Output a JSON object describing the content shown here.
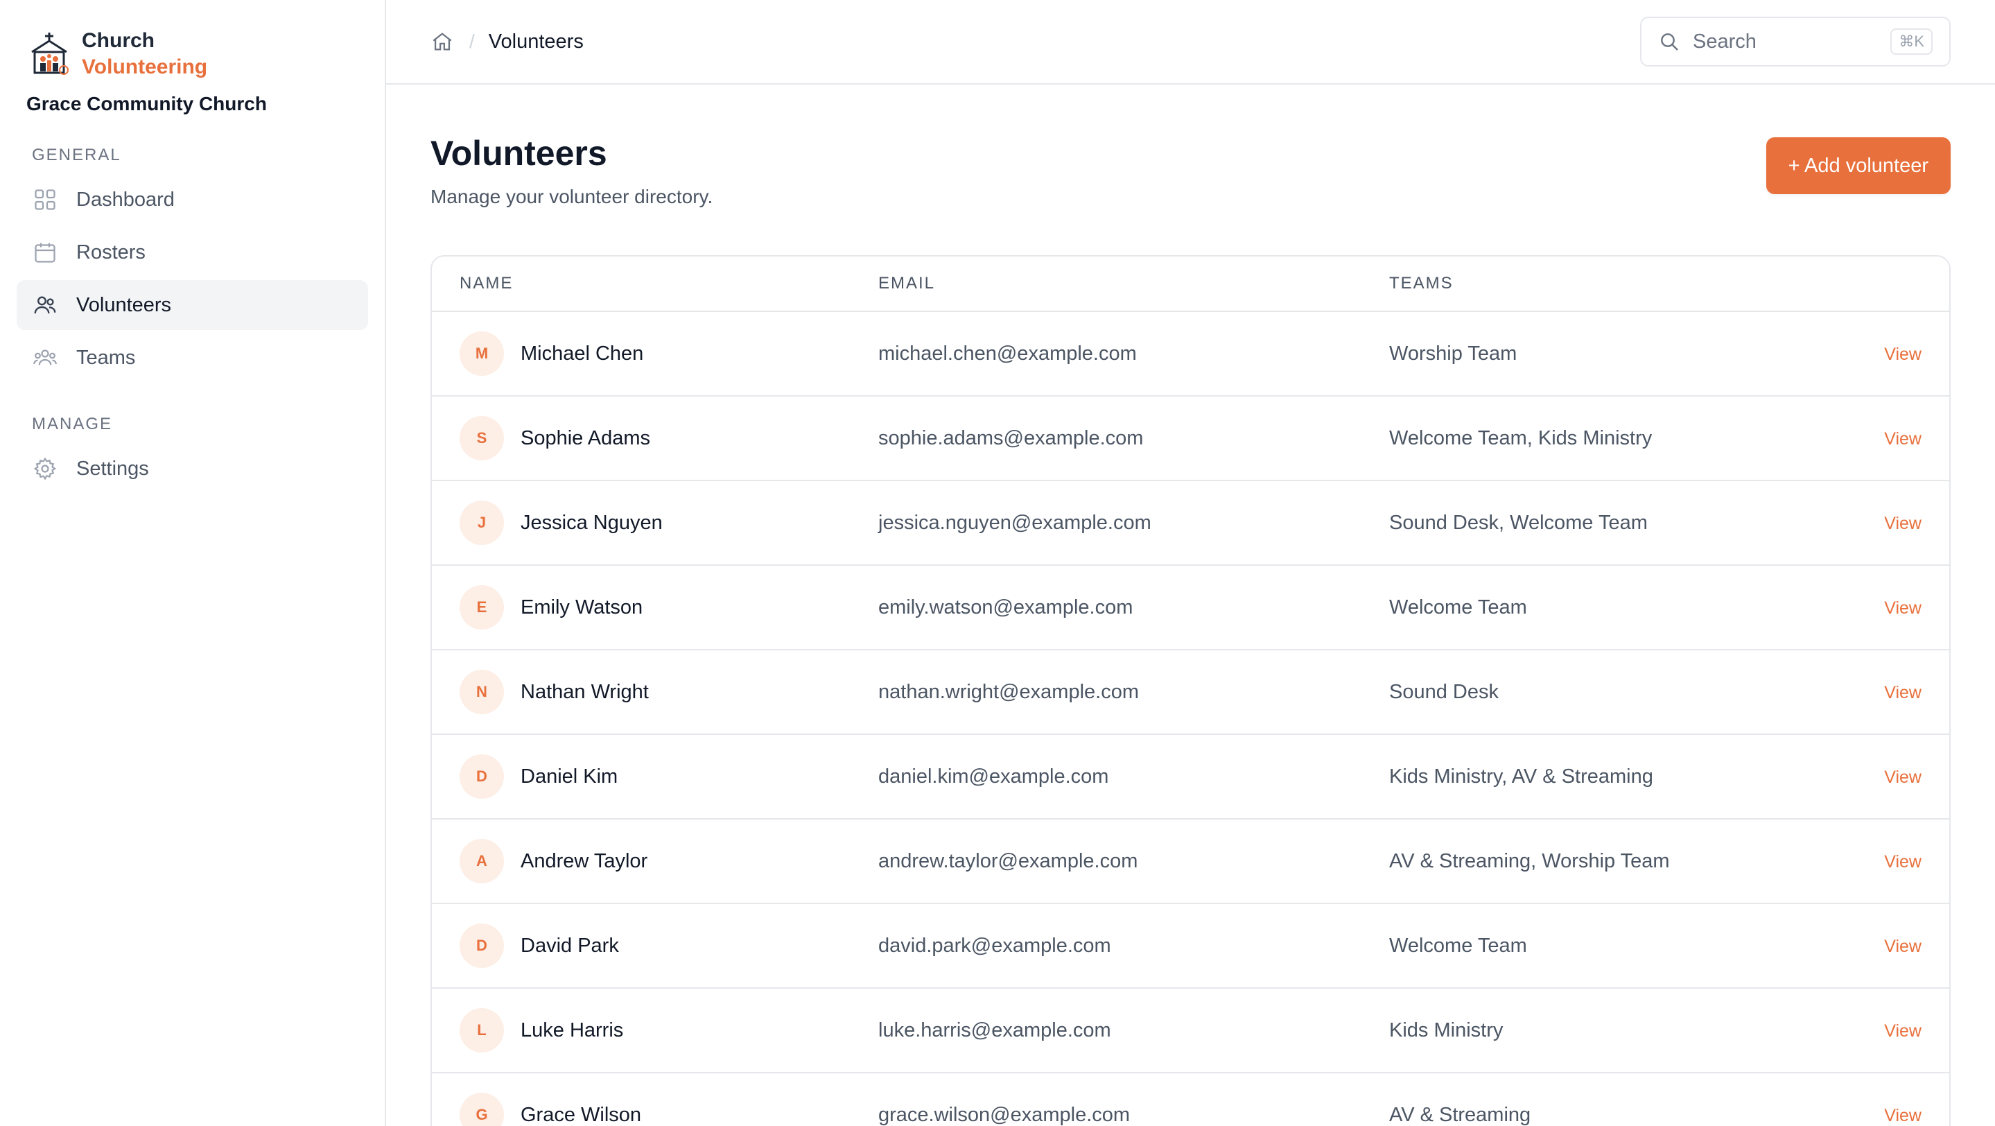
{
  "brand": {
    "line1": "Church",
    "line2": "Volunteering",
    "org": "Grace Community Church",
    "accent": "#e8703c"
  },
  "sidebar": {
    "sections": [
      {
        "title": "GENERAL",
        "items": [
          {
            "label": "Dashboard",
            "icon": "grid-icon",
            "active": false
          },
          {
            "label": "Rosters",
            "icon": "calendar-icon",
            "active": false
          },
          {
            "label": "Volunteers",
            "icon": "users-icon",
            "active": true
          },
          {
            "label": "Teams",
            "icon": "group-icon",
            "active": false
          }
        ]
      },
      {
        "title": "MANAGE",
        "items": [
          {
            "label": "Settings",
            "icon": "gear-icon",
            "active": false
          }
        ]
      }
    ]
  },
  "topbar": {
    "breadcrumb_sep": "/",
    "breadcrumb_current": "Volunteers",
    "search_placeholder": "Search",
    "search_shortcut": "⌘K"
  },
  "page": {
    "title": "Volunteers",
    "subtitle": "Manage your volunteer directory.",
    "add_button": "+ Add volunteer"
  },
  "table": {
    "headers": {
      "name": "NAME",
      "email": "EMAIL",
      "teams": "TEAMS"
    },
    "action_label": "View",
    "rows": [
      {
        "initial": "M",
        "name": "Michael Chen",
        "email": "michael.chen@example.com",
        "teams": "Worship Team"
      },
      {
        "initial": "S",
        "name": "Sophie Adams",
        "email": "sophie.adams@example.com",
        "teams": "Welcome Team, Kids Ministry"
      },
      {
        "initial": "J",
        "name": "Jessica Nguyen",
        "email": "jessica.nguyen@example.com",
        "teams": "Sound Desk, Welcome Team"
      },
      {
        "initial": "E",
        "name": "Emily Watson",
        "email": "emily.watson@example.com",
        "teams": "Welcome Team"
      },
      {
        "initial": "N",
        "name": "Nathan Wright",
        "email": "nathan.wright@example.com",
        "teams": "Sound Desk"
      },
      {
        "initial": "D",
        "name": "Daniel Kim",
        "email": "daniel.kim@example.com",
        "teams": "Kids Ministry, AV & Streaming"
      },
      {
        "initial": "A",
        "name": "Andrew Taylor",
        "email": "andrew.taylor@example.com",
        "teams": "AV & Streaming, Worship Team"
      },
      {
        "initial": "D",
        "name": "David Park",
        "email": "david.park@example.com",
        "teams": "Welcome Team"
      },
      {
        "initial": "L",
        "name": "Luke Harris",
        "email": "luke.harris@example.com",
        "teams": "Kids Ministry"
      },
      {
        "initial": "G",
        "name": "Grace Wilson",
        "email": "grace.wilson@example.com",
        "teams": "AV & Streaming"
      }
    ]
  }
}
